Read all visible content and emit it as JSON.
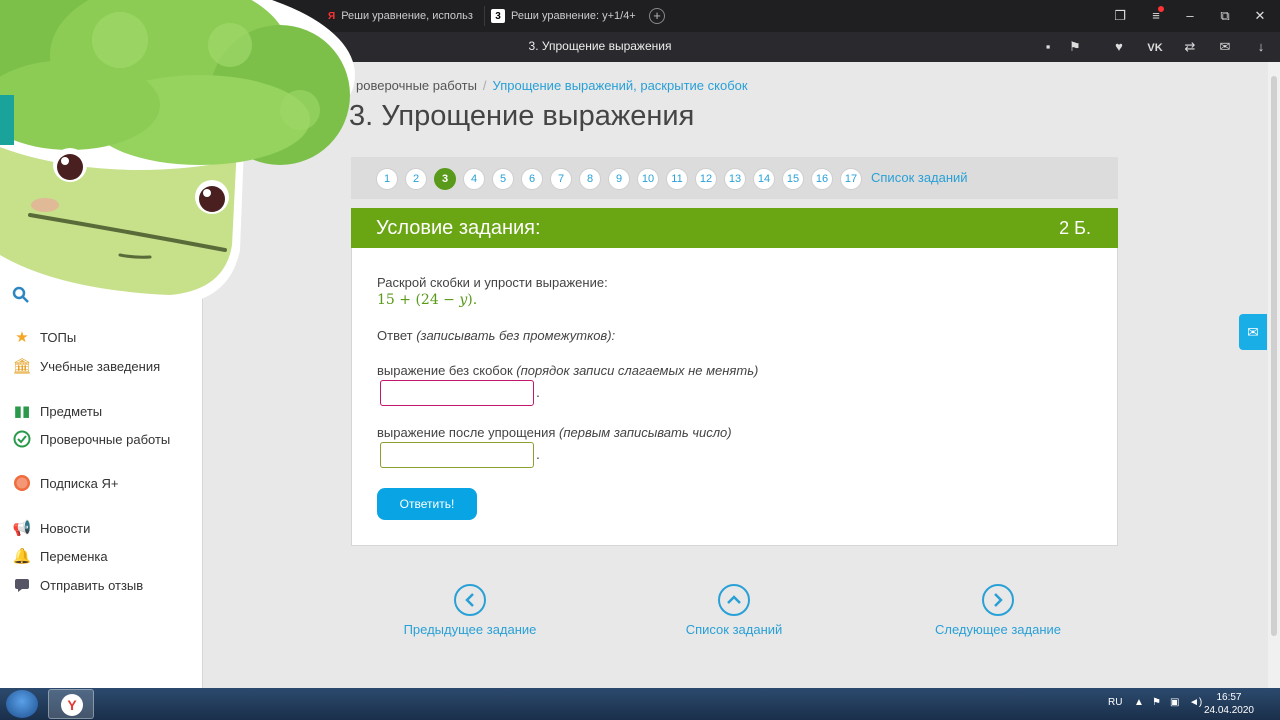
{
  "browser": {
    "tabs": [
      {
        "icon": "yandex-icon",
        "label": "Реши уравнение, использ"
      },
      {
        "icon": "tab-favicon-3",
        "favicon_text": "3",
        "label": "Реши уравнение: y+1/4+"
      }
    ],
    "page_title": "3. Упрощение выражения"
  },
  "sidebar": {
    "items": [
      {
        "icon": "star-icon",
        "label": "ТОПы"
      },
      {
        "icon": "university-icon",
        "label": "Учебные заведения"
      },
      {
        "icon": "books-icon",
        "label": "Предметы"
      },
      {
        "icon": "check-circle-icon",
        "label": "Проверочные работы"
      },
      {
        "icon": "ya-plus-icon",
        "label": "Подписка Я+"
      },
      {
        "icon": "megaphone-icon",
        "label": "Новости"
      },
      {
        "icon": "bell-icon",
        "label": "Переменка"
      },
      {
        "icon": "feedback-icon",
        "label": "Отправить отзыв"
      }
    ]
  },
  "breadcrumb": {
    "items": [
      "роверочные работы",
      "Упрощение выражений, раскрытие скобок"
    ],
    "separator": "/"
  },
  "page": {
    "title": "3. Упрощение выражения"
  },
  "pager": {
    "pages": [
      "1",
      "2",
      "3",
      "4",
      "5",
      "6",
      "7",
      "8",
      "9",
      "10",
      "11",
      "12",
      "13",
      "14",
      "15",
      "16",
      "17"
    ],
    "active": "3",
    "list_link": "Список заданий"
  },
  "task": {
    "header_title": "Условие задания:",
    "points": "2 Б.",
    "instruction": "Раскрой скобки и упрости выражение:",
    "expression": {
      "part1": "15 + (24 − ",
      "var": "y",
      "part2": ")."
    },
    "answer_label": "Ответ",
    "answer_note": "(записывать без промежутков):",
    "field1_label": "выражение без скобок",
    "field1_note": "(порядок записи слагаемых не менять)",
    "field1_value": "",
    "field2_label": "выражение после упрощения",
    "field2_note": "(первым записывать число)",
    "field2_value": "",
    "period": ".",
    "submit": "Ответить!"
  },
  "nav": {
    "prev": "Предыдущее задание",
    "list": "Список заданий",
    "next": "Следующее задание"
  },
  "taskbar": {
    "lang": "RU",
    "time": "16:57",
    "date": "24.04.2020"
  },
  "colors": {
    "accent_green": "#6aa513",
    "link_blue": "#29a0d6",
    "button_blue": "#09a4e4"
  }
}
